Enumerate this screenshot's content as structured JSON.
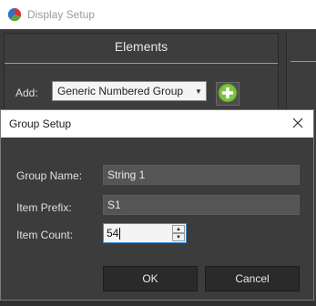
{
  "app": {
    "title": "Display Setup",
    "icon": "app-logo-icon"
  },
  "elements": {
    "header": "Elements",
    "add_label": "Add:",
    "add_select_value": "Generic Numbered Group",
    "add_button_icon": "plus-circle-icon"
  },
  "dialog": {
    "title": "Group Setup",
    "close_icon": "close-icon",
    "fields": {
      "group_name_label": "Group Name:",
      "group_name_value": "String 1",
      "item_prefix_label": "Item Prefix:",
      "item_prefix_value": "S1",
      "item_count_label": "Item Count:",
      "item_count_value": "54"
    },
    "ok_label": "OK",
    "cancel_label": "Cancel"
  },
  "colors": {
    "background": "#3a3a3a",
    "dialog_bg": "#3c3c3c",
    "accent_green": "#7cc242",
    "focus_blue": "#3a8fd8"
  }
}
